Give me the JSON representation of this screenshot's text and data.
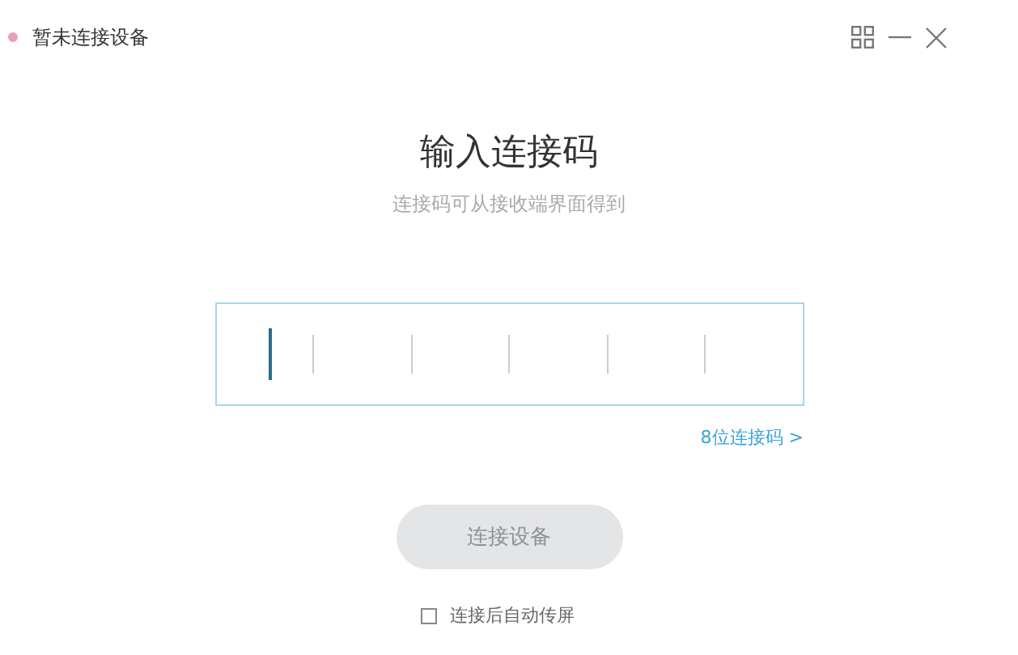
{
  "window": {
    "title": "暂未连接设备"
  },
  "heading": "输入连接码",
  "subtitle": "连接码可从接收端界面得到",
  "code_input": {
    "slots": [
      {
        "selected": true
      },
      {
        "selected": false
      },
      {
        "selected": false
      },
      {
        "selected": false
      },
      {
        "selected": false
      },
      {
        "selected": false
      }
    ]
  },
  "code_length_link": "8位连接码 >",
  "connect_button": {
    "label": "连接设备",
    "disabled": true
  },
  "auto_cast": {
    "label": "连接后自动传屏",
    "checked": false
  }
}
